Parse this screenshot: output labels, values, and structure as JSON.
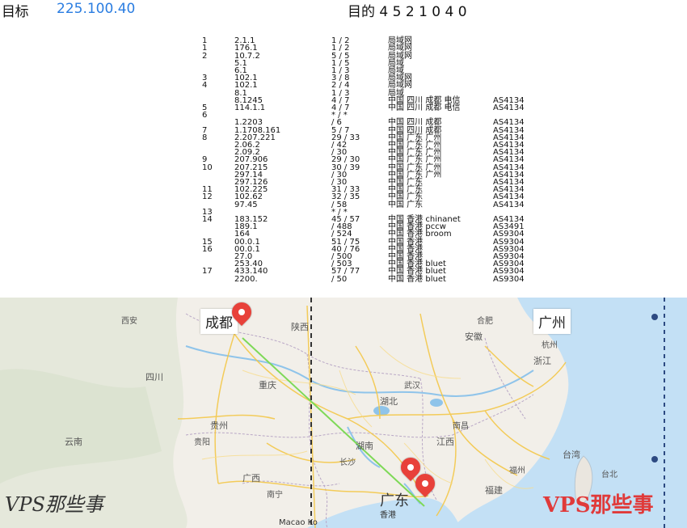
{
  "window": {
    "title_left": "目标",
    "target_ip": "225.100.40",
    "title_center": "目的 4 5 2 1 0 4 0"
  },
  "trace": {
    "rows": [
      {
        "hop": "",
        "ip": "",
        "time": "",
        "loss": "",
        "loc": "",
        "asn": ""
      },
      {
        "hop": "1",
        "ip": "2.1.1",
        "time": "1 / 2",
        "loss": "",
        "loc": "局域网",
        "asn": ""
      },
      {
        "hop": "1",
        "ip": "176.1",
        "time": "1 / 2",
        "loss": "",
        "loc": "局域网",
        "asn": ""
      },
      {
        "hop": "2",
        "ip": "10.7.2",
        "time": "5 / 5",
        "loss": "",
        "loc": "局域网",
        "asn": ""
      },
      {
        "hop": "",
        "ip": "5.1",
        "time": "1 / 5",
        "loss": "",
        "loc": "局域",
        "asn": ""
      },
      {
        "hop": "",
        "ip": "6.1",
        "time": "1 / 3",
        "loss": "",
        "loc": "局域",
        "asn": ""
      },
      {
        "hop": "3",
        "ip": "102.1",
        "time": "3 / 8",
        "loss": "",
        "loc": "局域网",
        "asn": ""
      },
      {
        "hop": "4",
        "ip": "102.1",
        "time": "2 / 4",
        "loss": "",
        "loc": "局域网",
        "asn": ""
      },
      {
        "hop": "",
        "ip": "8.1",
        "time": "1 / 3",
        "loss": "",
        "loc": "局域",
        "asn": ""
      },
      {
        "hop": "",
        "ip": "8.1245",
        "time": "4 / 7",
        "loss": "",
        "loc": "中国 四川 成都 电信",
        "asn": "AS4134"
      },
      {
        "hop": "5",
        "ip": "114.1.1",
        "time": "4 / 7",
        "loss": "",
        "loc": "中国 四川 成都 电信",
        "asn": "AS4134"
      },
      {
        "hop": "6",
        "ip": "",
        "time": "* / *",
        "loss": "",
        "loc": "",
        "asn": ""
      },
      {
        "hop": "",
        "ip": "1.2203",
        "time": "/ 6",
        "loss": "",
        "loc": "中国 四川 成都",
        "asn": "AS4134"
      },
      {
        "hop": "7",
        "ip": "1.1708.161",
        "time": "5 / 7",
        "loss": "",
        "loc": "中国 四川 成都",
        "asn": "AS4134"
      },
      {
        "hop": "8",
        "ip": "2.207.221",
        "time": "29 / 33",
        "loss": "",
        "loc": "中国 广东 广州",
        "asn": "AS4134"
      },
      {
        "hop": "",
        "ip": "2.06.2",
        "time": "/ 42",
        "loss": "",
        "loc": "中国 广东 广州",
        "asn": "AS4134"
      },
      {
        "hop": "",
        "ip": "2.09.2",
        "time": "/ 30",
        "loss": "",
        "loc": "中国 广东 广州",
        "asn": "AS4134"
      },
      {
        "hop": "9",
        "ip": "207.906",
        "time": "29 / 30",
        "loss": "",
        "loc": "中国 广东 广州",
        "asn": "AS4134"
      },
      {
        "hop": "10",
        "ip": "207.215",
        "time": "30 / 39",
        "loss": "",
        "loc": "中国 广东 广州",
        "asn": "AS4134"
      },
      {
        "hop": "",
        "ip": "297.14",
        "time": "/ 30",
        "loss": "",
        "loc": "中国 广东 广州",
        "asn": "AS4134"
      },
      {
        "hop": "",
        "ip": "297.126",
        "time": "/ 30",
        "loss": "",
        "loc": "中国 广东",
        "asn": "AS4134"
      },
      {
        "hop": "11",
        "ip": "102.225",
        "time": "31 / 33",
        "loss": "",
        "loc": "中国 广东",
        "asn": "AS4134"
      },
      {
        "hop": "12",
        "ip": "102.62",
        "time": "32 / 35",
        "loss": "",
        "loc": "中国 广东",
        "asn": "AS4134"
      },
      {
        "hop": "",
        "ip": "97.45",
        "time": "/ 58",
        "loss": "",
        "loc": "中国 广东",
        "asn": "AS4134"
      },
      {
        "hop": "13",
        "ip": "",
        "time": "* / *",
        "loss": "",
        "loc": "",
        "asn": ""
      },
      {
        "hop": "14",
        "ip": "183.152",
        "time": "45 / 57",
        "loss": "",
        "loc": "中国 香港 chinanet",
        "asn": "AS4134"
      },
      {
        "hop": "",
        "ip": "189.1",
        "time": "/ 488",
        "loss": "",
        "loc": "中国 香港 pccw",
        "asn": "AS3491"
      },
      {
        "hop": "",
        "ip": "164",
        "time": "/ 524",
        "loss": "",
        "loc": "中国 香港 broom",
        "asn": "AS9304"
      },
      {
        "hop": "15",
        "ip": "00.0.1",
        "time": "51 / 75",
        "loss": "",
        "loc": "中国 香港",
        "asn": "AS9304"
      },
      {
        "hop": "16",
        "ip": "00.0.1",
        "time": "40 / 76",
        "loss": "",
        "loc": "中国 香港",
        "asn": "AS9304"
      },
      {
        "hop": "",
        "ip": "27.0",
        "time": "/ 500",
        "loss": "",
        "loc": "中国 香港",
        "asn": "AS9304"
      },
      {
        "hop": "",
        "ip": "253.40",
        "time": "/ 503",
        "loss": "",
        "loc": "中国 香港 bluet",
        "asn": "AS9304"
      },
      {
        "hop": "17",
        "ip": "433.140",
        "time": "57 / 77",
        "loss": "",
        "loc": "中国 香港 bluet",
        "asn": "AS9304"
      },
      {
        "hop": "",
        "ip": "2200.",
        "time": "/ 50",
        "loss": "",
        "loc": "中国 香港 bluet",
        "asn": "AS9304"
      }
    ]
  },
  "map": {
    "pins": [
      {
        "name": "origin",
        "label": "成都"
      },
      {
        "name": "dest-1",
        "label": "广州"
      },
      {
        "name": "dest-2",
        "label": "香港"
      }
    ],
    "regions": {
      "shaanxi": "陕西",
      "hubei": "湖北",
      "hunan": "湖南",
      "guangdong": "广东",
      "guangxi": "广西",
      "fujian": "福建",
      "jiangxi": "江西",
      "zhejiang": "浙江",
      "anhui": "安徽",
      "guizhou": "贵州",
      "yunnan": "云南",
      "chongqing": "重庆",
      "sichuan": "四川",
      "taiwan": "台湾",
      "hongkong": "香港",
      "macao": "Macao Ko"
    },
    "cities": {
      "wuhan": "武汉",
      "changsha": "长沙",
      "nanchang": "南昌",
      "guiyang": "贵阳",
      "nanning": "南宁",
      "fuzhou": "福州",
      "hangzhou": "杭州",
      "hefei": "合肥",
      "taipei": "台北",
      "xian": "西安"
    },
    "watermark_left": "VPS那些事",
    "watermark_right": "VPS那些事",
    "colors": {
      "land": "#f2efe9",
      "water": "#a9d3f0",
      "sea": "#c3e0f5",
      "roads": "#f4c84a",
      "route": "#7ed957"
    }
  }
}
